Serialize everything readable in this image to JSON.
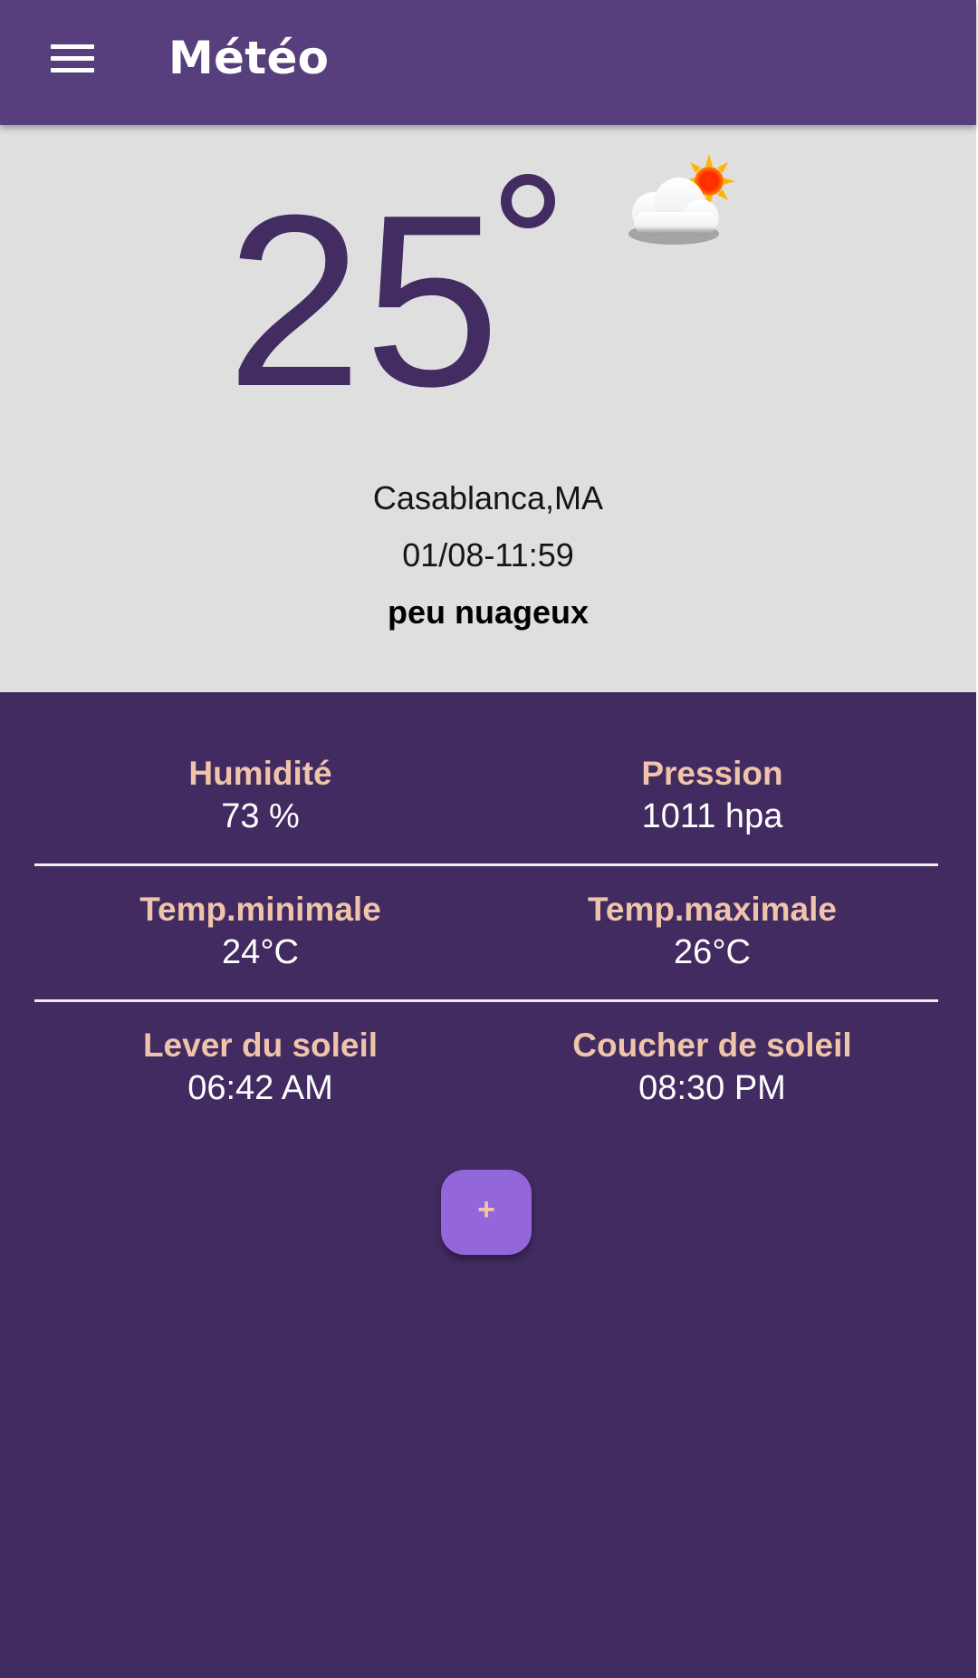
{
  "app_bar": {
    "title": "Météo",
    "menu_icon": "menu-icon"
  },
  "current": {
    "temperature": "25",
    "degree_symbol_icon": "degree-icon",
    "weather_icon": "partly-cloudy-icon",
    "city": "Casablanca,MA",
    "datetime": "01/08-11:59",
    "description": "peu nuageux"
  },
  "details": {
    "humidity": {
      "label": "Humidité",
      "value": "73 %"
    },
    "pressure": {
      "label": "Pression",
      "value": "1011 hpa"
    },
    "temp_min": {
      "label": "Temp.minimale",
      "value": "24°C"
    },
    "temp_max": {
      "label": "Temp.maximale",
      "value": "26°C"
    },
    "sunrise": {
      "label": "Lever du soleil",
      "value": "06:42 AM"
    },
    "sunset": {
      "label": "Coucher de soleil",
      "value": "08:30 PM"
    }
  },
  "fab": {
    "label": "+"
  },
  "colors": {
    "app_bar": "#573e7c",
    "current_bg": "#dfdfdf",
    "temperature": "#422c62",
    "details_bg": "#412b61",
    "detail_label": "#f0c4aa",
    "detail_value": "#ffffff",
    "fab": "#9366d9"
  }
}
